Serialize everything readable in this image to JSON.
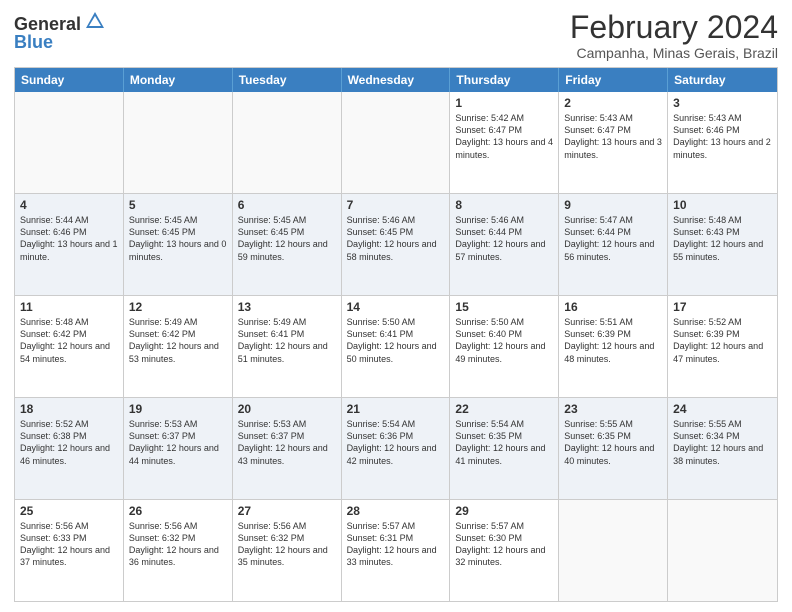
{
  "logo": {
    "general": "General",
    "blue": "Blue"
  },
  "header": {
    "title": "February 2024",
    "subtitle": "Campanha, Minas Gerais, Brazil"
  },
  "days_of_week": [
    "Sunday",
    "Monday",
    "Tuesday",
    "Wednesday",
    "Thursday",
    "Friday",
    "Saturday"
  ],
  "weeks": [
    [
      {
        "day": "",
        "info": ""
      },
      {
        "day": "",
        "info": ""
      },
      {
        "day": "",
        "info": ""
      },
      {
        "day": "",
        "info": ""
      },
      {
        "day": "1",
        "info": "Sunrise: 5:42 AM\nSunset: 6:47 PM\nDaylight: 13 hours and 4 minutes."
      },
      {
        "day": "2",
        "info": "Sunrise: 5:43 AM\nSunset: 6:47 PM\nDaylight: 13 hours and 3 minutes."
      },
      {
        "day": "3",
        "info": "Sunrise: 5:43 AM\nSunset: 6:46 PM\nDaylight: 13 hours and 2 minutes."
      }
    ],
    [
      {
        "day": "4",
        "info": "Sunrise: 5:44 AM\nSunset: 6:46 PM\nDaylight: 13 hours and 1 minute."
      },
      {
        "day": "5",
        "info": "Sunrise: 5:45 AM\nSunset: 6:45 PM\nDaylight: 13 hours and 0 minutes."
      },
      {
        "day": "6",
        "info": "Sunrise: 5:45 AM\nSunset: 6:45 PM\nDaylight: 12 hours and 59 minutes."
      },
      {
        "day": "7",
        "info": "Sunrise: 5:46 AM\nSunset: 6:45 PM\nDaylight: 12 hours and 58 minutes."
      },
      {
        "day": "8",
        "info": "Sunrise: 5:46 AM\nSunset: 6:44 PM\nDaylight: 12 hours and 57 minutes."
      },
      {
        "day": "9",
        "info": "Sunrise: 5:47 AM\nSunset: 6:44 PM\nDaylight: 12 hours and 56 minutes."
      },
      {
        "day": "10",
        "info": "Sunrise: 5:48 AM\nSunset: 6:43 PM\nDaylight: 12 hours and 55 minutes."
      }
    ],
    [
      {
        "day": "11",
        "info": "Sunrise: 5:48 AM\nSunset: 6:42 PM\nDaylight: 12 hours and 54 minutes."
      },
      {
        "day": "12",
        "info": "Sunrise: 5:49 AM\nSunset: 6:42 PM\nDaylight: 12 hours and 53 minutes."
      },
      {
        "day": "13",
        "info": "Sunrise: 5:49 AM\nSunset: 6:41 PM\nDaylight: 12 hours and 51 minutes."
      },
      {
        "day": "14",
        "info": "Sunrise: 5:50 AM\nSunset: 6:41 PM\nDaylight: 12 hours and 50 minutes."
      },
      {
        "day": "15",
        "info": "Sunrise: 5:50 AM\nSunset: 6:40 PM\nDaylight: 12 hours and 49 minutes."
      },
      {
        "day": "16",
        "info": "Sunrise: 5:51 AM\nSunset: 6:39 PM\nDaylight: 12 hours and 48 minutes."
      },
      {
        "day": "17",
        "info": "Sunrise: 5:52 AM\nSunset: 6:39 PM\nDaylight: 12 hours and 47 minutes."
      }
    ],
    [
      {
        "day": "18",
        "info": "Sunrise: 5:52 AM\nSunset: 6:38 PM\nDaylight: 12 hours and 46 minutes."
      },
      {
        "day": "19",
        "info": "Sunrise: 5:53 AM\nSunset: 6:37 PM\nDaylight: 12 hours and 44 minutes."
      },
      {
        "day": "20",
        "info": "Sunrise: 5:53 AM\nSunset: 6:37 PM\nDaylight: 12 hours and 43 minutes."
      },
      {
        "day": "21",
        "info": "Sunrise: 5:54 AM\nSunset: 6:36 PM\nDaylight: 12 hours and 42 minutes."
      },
      {
        "day": "22",
        "info": "Sunrise: 5:54 AM\nSunset: 6:35 PM\nDaylight: 12 hours and 41 minutes."
      },
      {
        "day": "23",
        "info": "Sunrise: 5:55 AM\nSunset: 6:35 PM\nDaylight: 12 hours and 40 minutes."
      },
      {
        "day": "24",
        "info": "Sunrise: 5:55 AM\nSunset: 6:34 PM\nDaylight: 12 hours and 38 minutes."
      }
    ],
    [
      {
        "day": "25",
        "info": "Sunrise: 5:56 AM\nSunset: 6:33 PM\nDaylight: 12 hours and 37 minutes."
      },
      {
        "day": "26",
        "info": "Sunrise: 5:56 AM\nSunset: 6:32 PM\nDaylight: 12 hours and 36 minutes."
      },
      {
        "day": "27",
        "info": "Sunrise: 5:56 AM\nSunset: 6:32 PM\nDaylight: 12 hours and 35 minutes."
      },
      {
        "day": "28",
        "info": "Sunrise: 5:57 AM\nSunset: 6:31 PM\nDaylight: 12 hours and 33 minutes."
      },
      {
        "day": "29",
        "info": "Sunrise: 5:57 AM\nSunset: 6:30 PM\nDaylight: 12 hours and 32 minutes."
      },
      {
        "day": "",
        "info": ""
      },
      {
        "day": "",
        "info": ""
      }
    ]
  ]
}
